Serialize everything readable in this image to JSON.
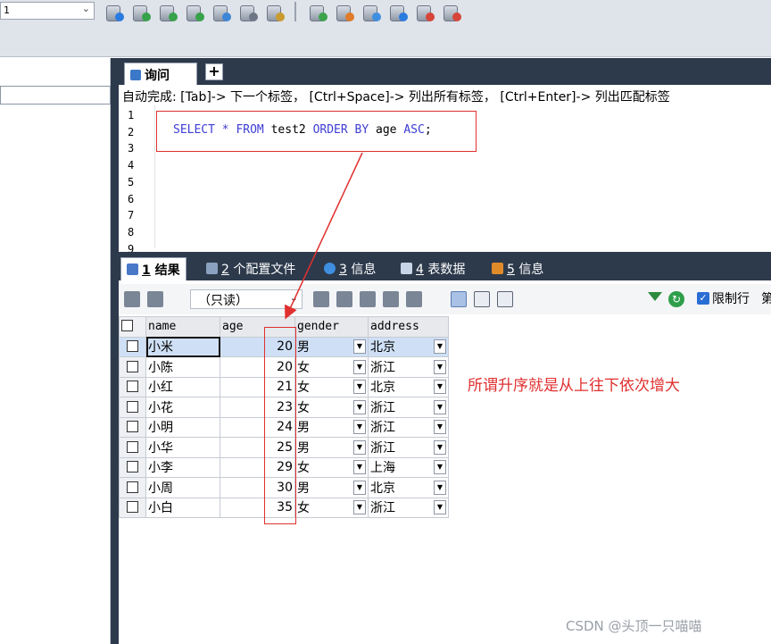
{
  "toolbar": {
    "db_value": "1",
    "icons": [
      "add-database-icon",
      "create-table-icon",
      "copy-database-icon",
      "import-icon",
      "backup-icon",
      "schema-icon",
      "query-builder-icon",
      "sync-icon",
      "data-sync-icon",
      "schedule-icon",
      "history-icon",
      "restore-icon",
      "tools-icon"
    ]
  },
  "editor": {
    "query_tab_label": "询问",
    "add_tab_label": "+",
    "autocomplete_hint": "自动完成: [Tab]-> 下一个标签， [Ctrl+Space]-> 列出所有标签， [Ctrl+Enter]-> 列出匹配标签",
    "line_numbers": [
      "1",
      "2",
      "3",
      "4",
      "5",
      "6",
      "7",
      "8",
      "9"
    ],
    "sql": {
      "select": "SELECT",
      "star": "*",
      "from": "FROM",
      "table": "test2",
      "order": "ORDER",
      "by": "BY",
      "column": "age",
      "asc": "ASC",
      "semi": ";"
    }
  },
  "result_tabs": [
    {
      "num": "1",
      "label": "结果"
    },
    {
      "num": "2",
      "label": "个配置文件"
    },
    {
      "num": "3",
      "label": "信息"
    },
    {
      "num": "4",
      "label": "表数据"
    },
    {
      "num": "5",
      "label": "信息"
    }
  ],
  "result_toolbar": {
    "readonly_label": "（只读）",
    "limit_label": "限制行",
    "extra_label": "第"
  },
  "grid": {
    "columns": [
      "name",
      "age",
      "gender",
      "address"
    ],
    "rows": [
      {
        "name": "小米",
        "age": "20",
        "gender": "男",
        "address": "北京"
      },
      {
        "name": "小陈",
        "age": "20",
        "gender": "女",
        "address": "浙江"
      },
      {
        "name": "小红",
        "age": "21",
        "gender": "女",
        "address": "北京"
      },
      {
        "name": "小花",
        "age": "23",
        "gender": "女",
        "address": "浙江"
      },
      {
        "name": "小明",
        "age": "24",
        "gender": "男",
        "address": "浙江"
      },
      {
        "name": "小华",
        "age": "25",
        "gender": "男",
        "address": "浙江"
      },
      {
        "name": "小李",
        "age": "29",
        "gender": "女",
        "address": "上海"
      },
      {
        "name": "小周",
        "age": "30",
        "gender": "男",
        "address": "北京"
      },
      {
        "name": "小白",
        "age": "35",
        "gender": "女",
        "address": "浙江"
      }
    ]
  },
  "annotation": "所谓升序就是从上往下依次增大",
  "watermark": "CSDN @头顶一只喵喵",
  "colors": {
    "annotation_red": "#e0302f",
    "dark_panel": "#2d3a4c",
    "sql_keyword": "#3d3dd6"
  }
}
